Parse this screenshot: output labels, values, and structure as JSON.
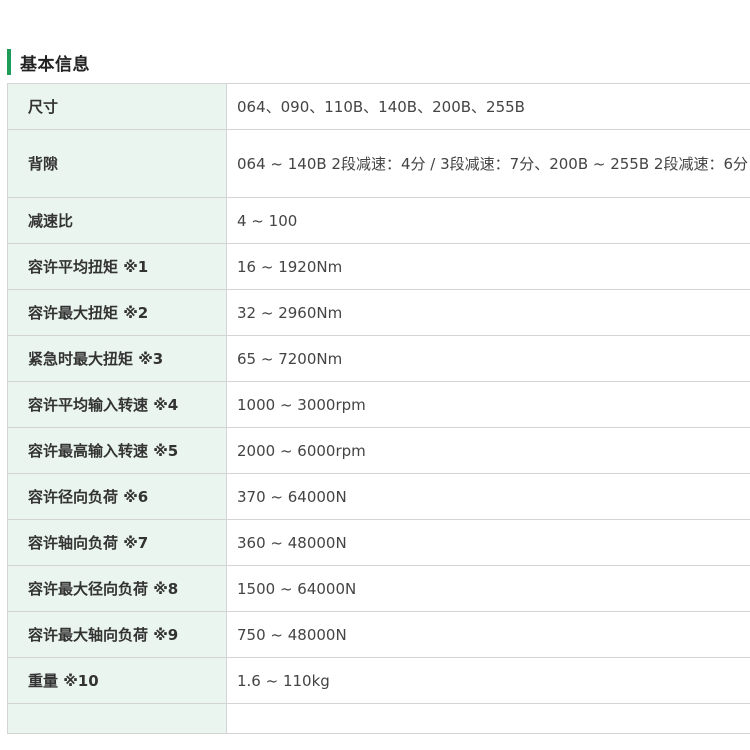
{
  "section": {
    "title": "基本信息"
  },
  "specs": [
    {
      "label": "尺寸",
      "value": "064、090、110B、140B、200B、255B"
    },
    {
      "label": "背隙",
      "value": "064 ~ 140B 2段减速：4分 / 3段减速：7分、200B ~ 255B 2段减速：6分"
    },
    {
      "label": "减速比",
      "value": "4 ~ 100"
    },
    {
      "label": "容许平均扭矩 ※1",
      "value": "16 ~ 1920Nm"
    },
    {
      "label": "容许最大扭矩 ※2",
      "value": "32 ~ 2960Nm"
    },
    {
      "label": "紧急时最大扭矩 ※3",
      "value": "65 ~ 7200Nm"
    },
    {
      "label": "容许平均输入转速 ※4",
      "value": "1000 ~ 3000rpm"
    },
    {
      "label": "容许最高输入转速 ※5",
      "value": "2000 ~ 6000rpm"
    },
    {
      "label": "容许径向负荷 ※6",
      "value": "370 ~ 64000N"
    },
    {
      "label": "容许轴向负荷 ※7",
      "value": "360 ~ 48000N"
    },
    {
      "label": "容许最大径向负荷 ※8",
      "value": "1500 ~ 64000N"
    },
    {
      "label": "容许最大轴向负荷 ※9",
      "value": "750 ~ 48000N"
    },
    {
      "label": "重量 ※10",
      "value": "1.6 ~ 110kg"
    }
  ]
}
